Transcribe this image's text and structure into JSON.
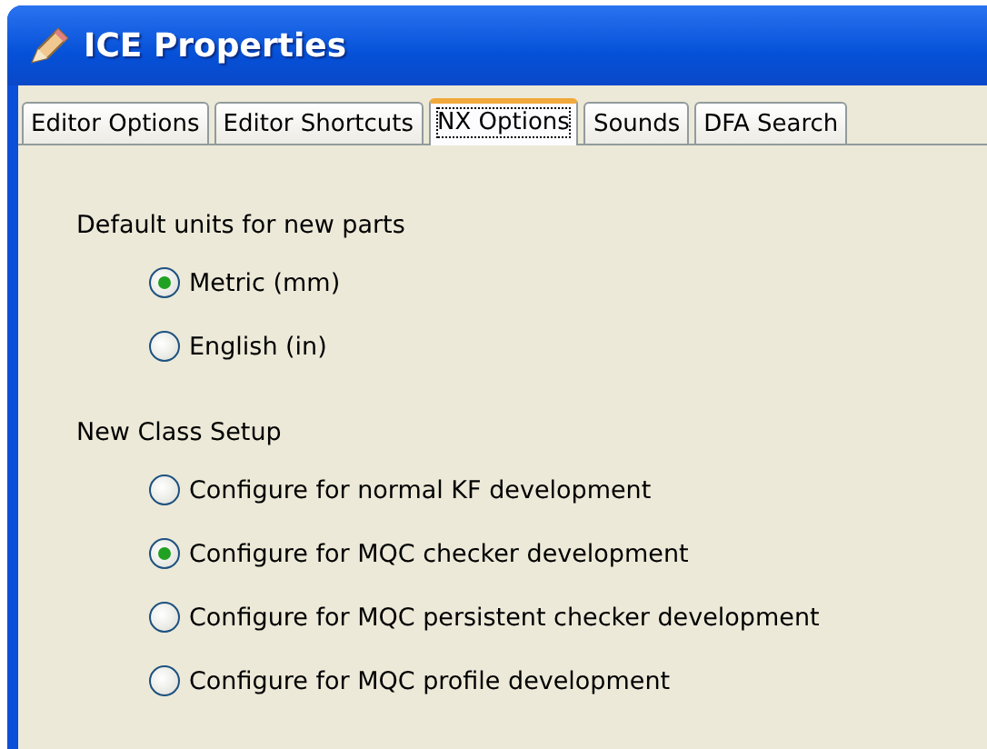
{
  "window": {
    "title": "ICE Properties"
  },
  "tabs": [
    {
      "label": "Editor Options",
      "selected": false
    },
    {
      "label": "Editor Shortcuts",
      "selected": false
    },
    {
      "label": "NX Options",
      "selected": true
    },
    {
      "label": "Sounds",
      "selected": false
    },
    {
      "label": "DFA Search",
      "selected": false
    }
  ],
  "groups": [
    {
      "label": "Default units for new parts",
      "options": [
        {
          "label": "Metric (mm)",
          "selected": true
        },
        {
          "label": "English (in)",
          "selected": false
        }
      ]
    },
    {
      "label": "New Class Setup",
      "options": [
        {
          "label": "Configure for normal KF development",
          "selected": false
        },
        {
          "label": "Configure for MQC checker development",
          "selected": true
        },
        {
          "label": "Configure for MQC persistent checker development",
          "selected": false
        },
        {
          "label": "Configure for MQC profile development",
          "selected": false
        }
      ]
    }
  ]
}
